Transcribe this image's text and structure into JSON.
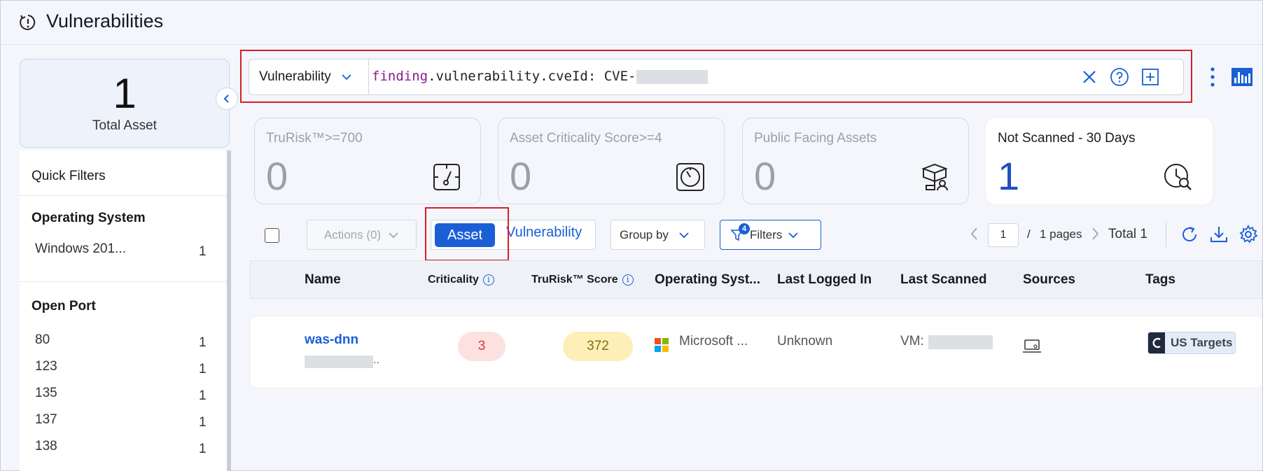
{
  "header": {
    "title": "Vulnerabilities"
  },
  "summary": {
    "total_count": "1",
    "total_label": "Total Asset"
  },
  "quick_filters": {
    "title": "Quick Filters",
    "groups": [
      {
        "title": "Operating System",
        "items": [
          {
            "label": "Windows 201...",
            "count": "1"
          }
        ]
      },
      {
        "title": "Open Port",
        "items": [
          {
            "label": "80",
            "count": "1"
          },
          {
            "label": "123",
            "count": "1"
          },
          {
            "label": "135",
            "count": "1"
          },
          {
            "label": "137",
            "count": "1"
          },
          {
            "label": "138",
            "count": "1"
          }
        ]
      }
    ]
  },
  "search": {
    "scope": "Vulnerability",
    "query_field": "finding",
    "query_rest": ".vulnerability.cveId: CVE-"
  },
  "stats": [
    {
      "label": "TruRisk™>=700",
      "value": "0",
      "icon": "trurisk-gauge-icon",
      "active": false
    },
    {
      "label": "Asset Criticality Score>=4",
      "value": "0",
      "icon": "criticality-gauge-icon",
      "active": false
    },
    {
      "label": "Public Facing Assets",
      "value": "0",
      "icon": "public-assets-icon",
      "active": false
    },
    {
      "label": "Not Scanned - 30 Days",
      "value": "1",
      "icon": "clock-search-icon",
      "active": true
    }
  ],
  "toolbar": {
    "actions_label": "Actions (0)",
    "asset_label": "Asset",
    "vulnerability_label": "Vulnerability",
    "groupby_label": "Group by",
    "filters_label": "Filters",
    "filters_count": "4",
    "page": "1",
    "page_sep": "/",
    "pages_label": "1 pages",
    "total_label": "Total 1"
  },
  "table": {
    "columns": [
      "Name",
      "Criticality",
      "TruRisk™ Score",
      "Operating Syst...",
      "Last Logged In",
      "Last Scanned",
      "Sources",
      "Tags"
    ],
    "rows": [
      {
        "name": "was-dnn",
        "sub_suffix": "..",
        "criticality": "3",
        "trurisk": "372",
        "os": "Microsoft ...",
        "last_logged_in": "Unknown",
        "last_scanned_prefix": "VM:",
        "tag": "US Targets"
      }
    ]
  },
  "colors": {
    "accent": "#1a5fd6",
    "highlight_border": "#d61f26",
    "criticality_bg": "#fde1e1",
    "trurisk_bg": "#fcefb8"
  }
}
